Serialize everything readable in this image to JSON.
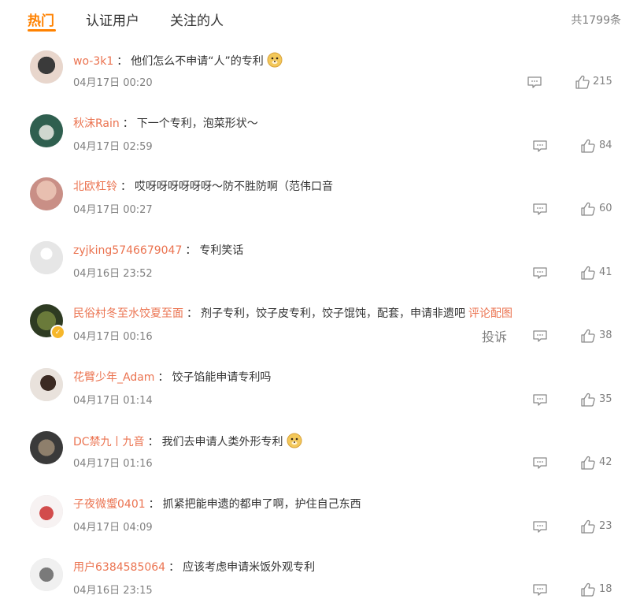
{
  "tabs": [
    {
      "label": "热门"
    },
    {
      "label": "认证用户"
    },
    {
      "label": "关注的人"
    }
  ],
  "total": "共1799条",
  "comments": [
    {
      "user": "wo-3k1",
      "text": "他们怎么不申请“人”的专利",
      "time": "04月17日 00:20",
      "likes": "215",
      "emoji": "doge-emoji"
    },
    {
      "user": "秋沫Rain",
      "text": "下一个专利，泡菜形状～",
      "time": "04月17日 02:59",
      "likes": "84"
    },
    {
      "user": "北欧杠铃",
      "text": "哎呀呀呀呀呀呀～防不胜防啊（范伟口音",
      "time": "04月17日 00:27",
      "likes": "60"
    },
    {
      "user": "zyjking5746679047",
      "text": "专利笑话",
      "time": "04月16日 23:52",
      "likes": "41"
    },
    {
      "user": "民俗村冬至水饺夏至面",
      "text": "剂子专利，饺子皮专利，饺子馄饨，配套，申请非遗吧",
      "link": "评论配图",
      "time": "04月17日 00:16",
      "likes": "38",
      "report": "投诉",
      "verified": true
    },
    {
      "user": "花臂少年_Adam",
      "text": "饺子馅能申请专利吗",
      "time": "04月17日 01:14",
      "likes": "35"
    },
    {
      "user": "DC禁九丨九音",
      "text": "我们去申请人类外形专利",
      "time": "04月17日 01:16",
      "likes": "42",
      "emoji": "doge-emoji"
    },
    {
      "user": "子夜微蠁0401",
      "text": "抓紧把能申遗的都申了啊，护住自己东西",
      "time": "04月17日 04:09",
      "likes": "23"
    },
    {
      "user": "用户6384585064",
      "text": "应该考虑申请米饭外观专利",
      "time": "04月16日 23:15",
      "likes": "18"
    }
  ],
  "colors": {
    "accent": "#ff8200",
    "username": "#eb7350",
    "meta": "#808080"
  }
}
